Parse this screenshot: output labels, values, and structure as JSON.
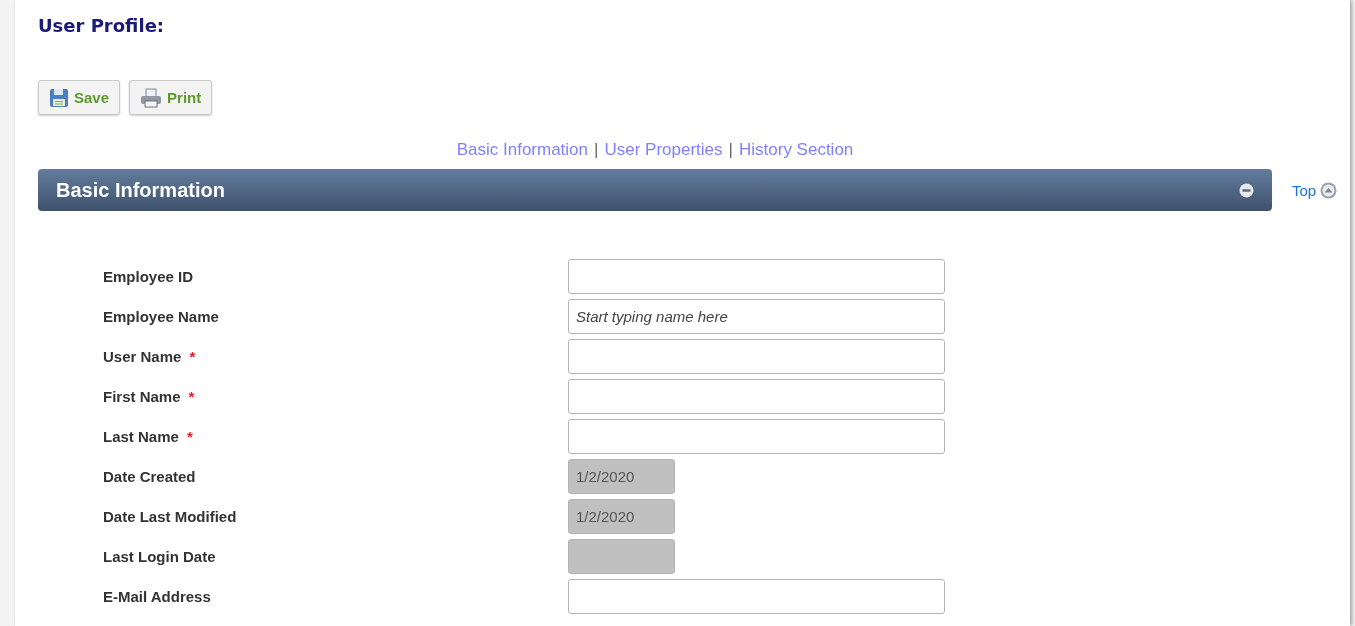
{
  "page_title": "User Profile:",
  "toolbar": [
    {
      "kind": "save",
      "label": "Save"
    },
    {
      "kind": "print",
      "label": "Print"
    }
  ],
  "section_nav": [
    {
      "label": "Basic Information"
    },
    {
      "label": "User Properties"
    },
    {
      "label": "History Section"
    }
  ],
  "nav_separator": "|",
  "section": {
    "title": "Basic Information",
    "expanded": true,
    "top_link": "Top"
  },
  "fields": [
    {
      "label": "Employee ID",
      "kind": "text"
    },
    {
      "label": "Employee Name",
      "kind": "text",
      "placeholder": "Start typing name here"
    },
    {
      "label": "User Name",
      "kind": "text",
      "required_mark": "*"
    },
    {
      "label": "First Name",
      "kind": "text",
      "required_mark": "*"
    },
    {
      "label": "Last Name",
      "kind": "text",
      "required_mark": "*"
    },
    {
      "label": "Date Created",
      "kind": "readonly",
      "value": "1/2/2020"
    },
    {
      "label": "Date Last Modified",
      "kind": "readonly",
      "value": "1/2/2020"
    },
    {
      "label": "Last Login Date",
      "kind": "readonly"
    },
    {
      "label": "E-Mail Address",
      "kind": "text"
    }
  ]
}
